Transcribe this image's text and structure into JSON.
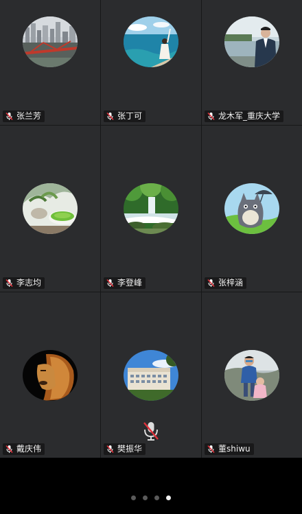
{
  "participants": [
    {
      "name": "张兰芳",
      "avatar": "city-bridge-photo"
    },
    {
      "name": "张丁可",
      "avatar": "seaside-woman-photo"
    },
    {
      "name": "龙木军_重庆大学",
      "avatar": "man-by-lake-photo"
    },
    {
      "name": "李志均",
      "avatar": "green-tea-photo"
    },
    {
      "name": "李登峰",
      "avatar": "waterfall-forest-photo"
    },
    {
      "name": "张梓涵",
      "avatar": "totoro-cartoon"
    },
    {
      "name": "戴庆伟",
      "avatar": "lion-photo"
    },
    {
      "name": "樊振华",
      "avatar": "building-photo"
    },
    {
      "name": "董shiwu",
      "avatar": "boy-and-child-photo"
    }
  ],
  "muted_icon": "microphone-muted-icon",
  "pager": {
    "pages": 4,
    "current": 4
  },
  "colors": {
    "tile_bg": "#2b2c2e",
    "mute_red": "#e0303a",
    "dot_active": "#f0f0f0",
    "dot_inactive": "#5a5a5a"
  }
}
